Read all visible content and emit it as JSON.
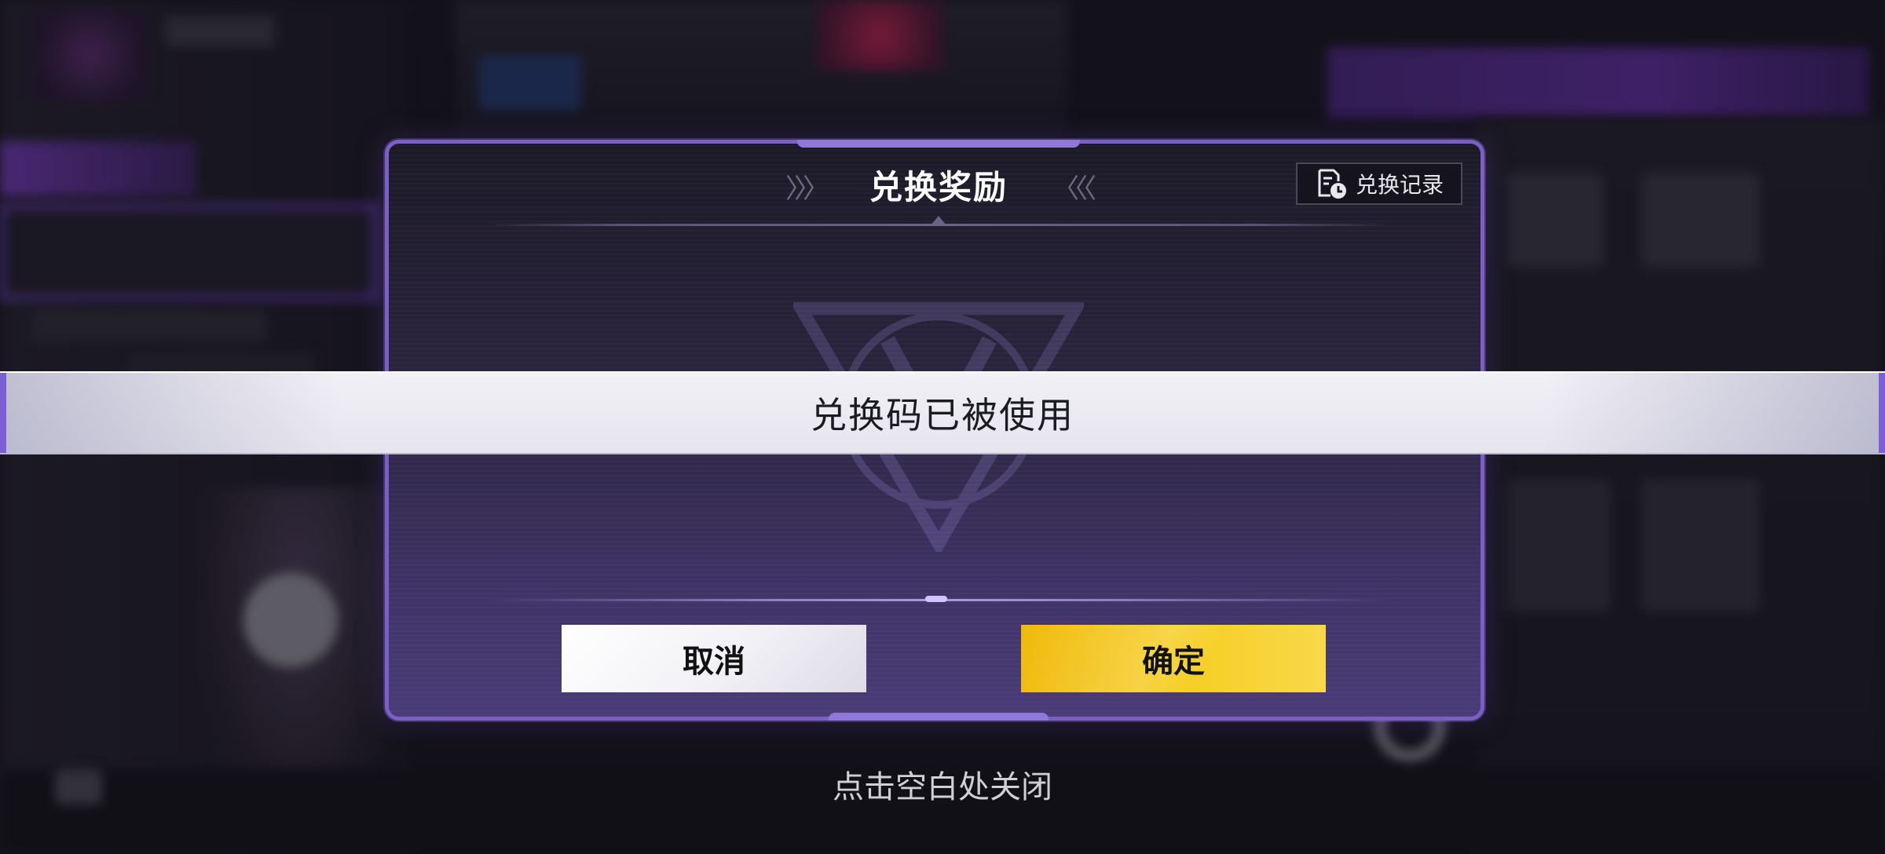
{
  "dialog": {
    "title": "兑换奖励",
    "history_button_label": "兑换记录",
    "cancel_label": "取消",
    "confirm_label": "确定"
  },
  "toast": {
    "message": "兑换码已被使用"
  },
  "overlay": {
    "close_hint": "点击空白处关闭"
  },
  "colors": {
    "dialog_border": "#7b5fc6",
    "confirm_button": "#f6cf24",
    "cancel_button": "#f2f1f6",
    "toast_background": "#eeedf4"
  },
  "icons": {
    "history": "history-record-icon",
    "title_decoration": "chevron-arrows-icon",
    "emblem": "game-emblem-watermark"
  }
}
